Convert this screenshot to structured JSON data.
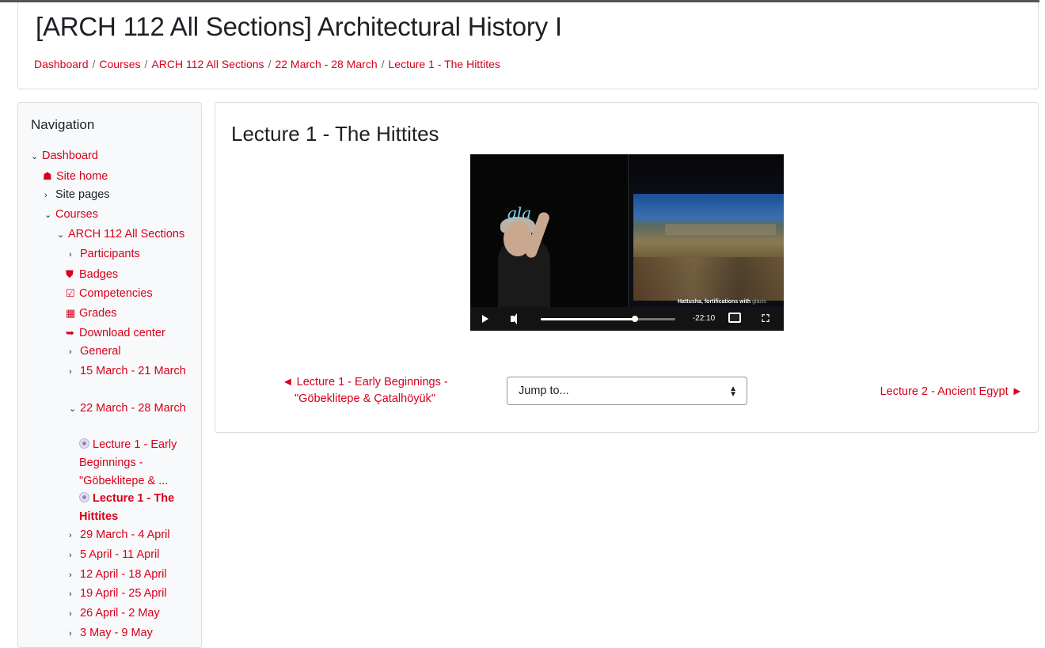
{
  "header": {
    "course_title": "[ARCH 112 All Sections] Architectural History I",
    "breadcrumb": [
      "Dashboard",
      "Courses",
      "ARCH 112 All Sections",
      "22 March - 28 March",
      "Lecture 1 - The Hittites"
    ],
    "breadcrumb_separator": "/"
  },
  "navigation": {
    "title": "Navigation",
    "items": [
      {
        "label": "Dashboard",
        "chevron": "⌄"
      },
      {
        "label": "Site home",
        "icon": "home-icon"
      },
      {
        "label": "Site pages",
        "chevron": "›"
      },
      {
        "label": "Courses",
        "chevron": "⌄"
      },
      {
        "label": "ARCH 112 All Sections",
        "chevron": "⌄"
      },
      {
        "label": "Participants",
        "chevron": "›"
      },
      {
        "label": "Badges",
        "icon": "shield-icon"
      },
      {
        "label": "Competencies",
        "icon": "checkbox-icon"
      },
      {
        "label": "Grades",
        "icon": "table-icon"
      },
      {
        "label": "Download center",
        "icon": "download-icon"
      },
      {
        "label": "General",
        "chevron": "›"
      },
      {
        "label": "15 March - 21 March",
        "chevron": "›"
      },
      {
        "label": "22 March - 28 March",
        "chevron": "⌄"
      },
      {
        "label": "Lecture 1 - Early Beginnings - \"Göbeklitepe & ...",
        "icon": "kaltura-video-icon"
      },
      {
        "label": "Lecture 1 - The Hittites",
        "icon": "kaltura-video-icon",
        "current": true
      },
      {
        "label": "29 March - 4 April",
        "chevron": "›"
      },
      {
        "label": "5 April - 11 April",
        "chevron": "›"
      },
      {
        "label": "12 April - 18 April",
        "chevron": "›"
      },
      {
        "label": "19 April - 25 April",
        "chevron": "›"
      },
      {
        "label": "26 April - 2 May",
        "chevron": "›"
      },
      {
        "label": "3 May - 9 May",
        "chevron": "›"
      }
    ]
  },
  "main": {
    "lecture_title": "Lecture 1 - The Hittites",
    "video": {
      "handwriting": "gla",
      "caption": "Hattusha, fortifications with",
      "caption_tail": "glacis",
      "time_remaining": "-22:10",
      "progress_fraction": 0.7
    },
    "prev_link": "◄ Lecture 1 - Early Beginnings - \"Göbeklitepe & Çatalhöyük\"",
    "jump_placeholder": "Jump to...",
    "next_link": "Lecture 2 - Ancient Egypt ►"
  },
  "colors": {
    "accent": "#d6001c",
    "text": "#1d2125",
    "nav_bg": "#f8f9fa"
  }
}
